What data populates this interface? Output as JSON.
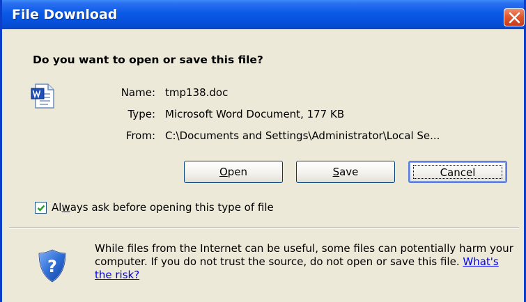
{
  "dialog": {
    "title": "File Download",
    "question": "Do you want to open or save this file?",
    "file": {
      "name_label": "Name:",
      "name_value": "tmp138.doc",
      "type_label": "Type:",
      "type_value": "Microsoft Word Document, 177 KB",
      "from_label": "From:",
      "from_value": "C:\\Documents and Settings\\Administrator\\Local Se..."
    },
    "buttons": {
      "open_hotkey": "O",
      "open_rest": "pen",
      "save_hotkey": "S",
      "save_rest": "ave",
      "cancel": "Cancel"
    },
    "checkbox": {
      "checked": true,
      "label_pre": "Al",
      "label_hotkey": "w",
      "label_post": "ays ask before opening this type of file"
    },
    "warning": {
      "text": "While files from the Internet can be useful, some files can potentially harm your computer. If you do not trust the source, do not open or save this file. ",
      "link": "What's the risk?"
    }
  },
  "icons": {
    "close": "close-icon",
    "file": "word-document-icon",
    "shield": "shield-question-icon",
    "check": "checkmark-icon"
  },
  "colors": {
    "titlebar": "#0a5ae6",
    "dialog_bg": "#ece9d8",
    "close_button": "#e0582e",
    "link": "#0000ee"
  }
}
